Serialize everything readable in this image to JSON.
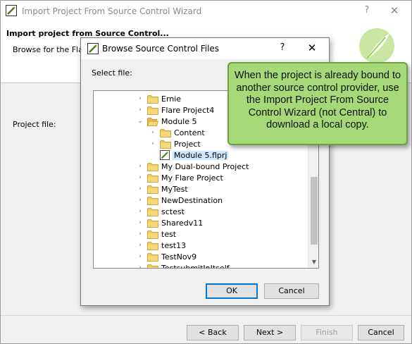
{
  "wizard": {
    "title": "Import Project From Source Control Wizard",
    "help_glyph": "?",
    "close_glyph": "✕",
    "heading": "Import project from Source Control...",
    "subtitle": "Browse for the Flare",
    "project_file_label": "Project file:",
    "buttons": {
      "back": "< Back",
      "next": "Next >",
      "finish": "Finish",
      "cancel": "Cancel"
    }
  },
  "dialog": {
    "title": "Browse Source Control Files",
    "help_glyph": "?",
    "close_glyph": "✕",
    "select_label": "Select file:",
    "tree": [
      {
        "label": "Ernie",
        "level": 0,
        "expander": "›",
        "type": "folder"
      },
      {
        "label": "Flare Project4",
        "level": 0,
        "expander": "›",
        "type": "folder"
      },
      {
        "label": "Module 5",
        "level": 0,
        "expander": "⌄",
        "type": "folder-open"
      },
      {
        "label": "Content",
        "level": 1,
        "expander": "›",
        "type": "folder"
      },
      {
        "label": "Project",
        "level": 1,
        "expander": "›",
        "type": "folder"
      },
      {
        "label": "Module 5.flprj",
        "level": 1,
        "expander": "",
        "type": "flare-file",
        "selected": true
      },
      {
        "label": "My Dual-bound Project",
        "level": 0,
        "expander": "›",
        "type": "folder"
      },
      {
        "label": "My Flare Project",
        "level": 0,
        "expander": "›",
        "type": "folder"
      },
      {
        "label": "MyTest",
        "level": 0,
        "expander": "›",
        "type": "folder"
      },
      {
        "label": "NewDestination",
        "level": 0,
        "expander": "›",
        "type": "folder"
      },
      {
        "label": "sctest",
        "level": 0,
        "expander": "›",
        "type": "folder"
      },
      {
        "label": "Sharedv11",
        "level": 0,
        "expander": "›",
        "type": "folder"
      },
      {
        "label": "test",
        "level": 0,
        "expander": "›",
        "type": "folder"
      },
      {
        "label": "test13",
        "level": 0,
        "expander": "›",
        "type": "folder"
      },
      {
        "label": "TestNov9",
        "level": 0,
        "expander": "›",
        "type": "folder"
      },
      {
        "label": "TestsubmitInItself",
        "level": 0,
        "expander": "›",
        "type": "folder"
      }
    ],
    "ok_label": "OK",
    "cancel_label": "Cancel"
  },
  "callout": {
    "text": "When the project is already bound to another source control provider, use the Import Project From Source Control Wizard (not Central) to download a local copy."
  },
  "colors": {
    "callout_fill": "#a5d876",
    "callout_border": "#6f9e46",
    "folder": "#f2c95a",
    "selection": "#cce8ff",
    "brand_green": "#8cc63f"
  }
}
